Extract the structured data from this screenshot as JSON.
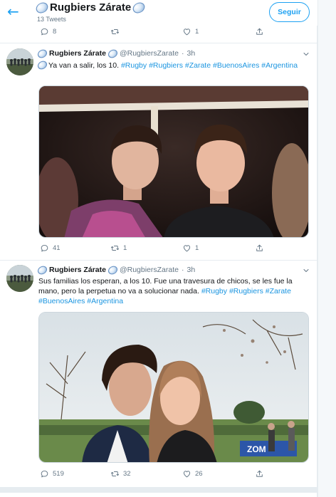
{
  "header": {
    "title": "Rugbiers Zárate",
    "tweet_count": "13 Tweets",
    "follow_label": "Seguir"
  },
  "top_actions": {
    "replies": "8",
    "retweets": "",
    "likes": "1"
  },
  "tweets": [
    {
      "name": "Rugbiers Zárate",
      "handle": "@RugbiersZarate",
      "separator": "·",
      "time": "3h",
      "text": "Ya van a salir, los 10.",
      "hashtags": [
        "#Rugby",
        "#Rugbiers",
        "#Zarate",
        "#BuenosAires",
        "#Argentina"
      ],
      "replies": "41",
      "retweets": "1",
      "likes": "1"
    },
    {
      "name": "Rugbiers Zárate",
      "handle": "@RugbiersZarate",
      "separator": "·",
      "time": "3h",
      "text": "Sus familias los esperan, a los 10. Fue una travesura de chicos, se les fue la mano, pero la perpetua no va a solucionar nada.",
      "hashtags": [
        "#Rugby",
        "#Rugbiers",
        "#Zarate",
        "#BuenosAires",
        "#Argentina"
      ],
      "sign_text": "ZOM",
      "replies": "519",
      "retweets": "32",
      "likes": "26"
    }
  ],
  "icons": {
    "back": "arrow-left-icon",
    "rugby_ball": "rugby-ball-icon",
    "reply": "speech-bubble-icon",
    "retweet": "retweet-icon",
    "like": "heart-icon",
    "share": "share-icon",
    "caret": "chevron-down-icon"
  },
  "colors": {
    "accent": "#1da1f2",
    "hashtag": "#1b95e0",
    "muted": "#657786",
    "border": "#e6ecf0"
  }
}
